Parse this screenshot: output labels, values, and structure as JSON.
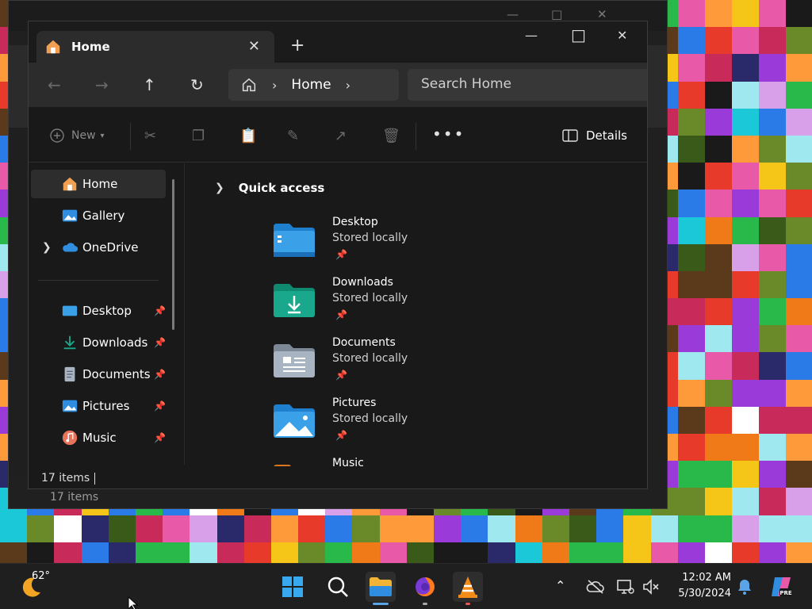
{
  "window": {
    "tab_title": "Home",
    "new_tab": "+",
    "minimize": "—",
    "maximize": "□",
    "close": "✕",
    "tab_close": "✕"
  },
  "nav": {
    "back": "←",
    "forward": "→",
    "up": "↑",
    "refresh": "↻",
    "breadcrumb": "Home",
    "chevron": "›",
    "search_placeholder": "Search Home"
  },
  "toolbar": {
    "new_label": "New",
    "more": "•••",
    "details_label": "Details"
  },
  "sidebar": {
    "items": [
      {
        "label": "Home"
      },
      {
        "label": "Gallery"
      },
      {
        "label": "OneDrive"
      },
      {
        "label": "Desktop"
      },
      {
        "label": "Downloads"
      },
      {
        "label": "Documents"
      },
      {
        "label": "Pictures"
      },
      {
        "label": "Music"
      }
    ]
  },
  "quick_access": {
    "title": "Quick access",
    "items": [
      {
        "name": "Desktop",
        "sub": "Stored locally"
      },
      {
        "name": "Downloads",
        "sub": "Stored locally"
      },
      {
        "name": "Documents",
        "sub": "Stored locally"
      },
      {
        "name": "Pictures",
        "sub": "Stored locally"
      },
      {
        "name": "Music",
        "sub": ""
      }
    ]
  },
  "status": {
    "items_count": "17 items"
  },
  "background_window": {
    "items_count": "17 items"
  },
  "taskbar": {
    "temperature": "62°",
    "time": "12:02 AM",
    "date": "5/30/2024"
  },
  "colors": {
    "accent": "#5aa3e6",
    "folder_blue": "#3aa0e8",
    "folder_teal": "#1aa88c",
    "folder_gray": "#a9b4c2"
  }
}
